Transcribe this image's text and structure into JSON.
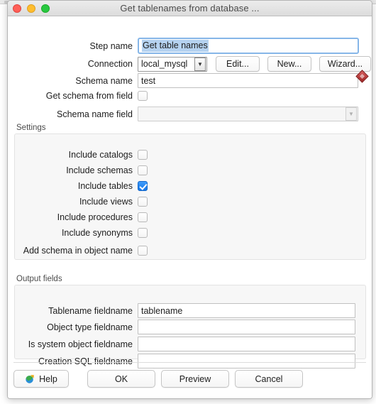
{
  "window": {
    "title": "Get tablenames from database ...",
    "traffic_lights": [
      "close-button",
      "minimize-button",
      "zoom-button"
    ]
  },
  "form": {
    "step_name": {
      "label": "Step name",
      "value": "Get table names",
      "selected": true
    },
    "connection": {
      "label": "Connection",
      "value": "local_mysql",
      "buttons": [
        {
          "name": "edit-button",
          "label": "Edit..."
        },
        {
          "name": "new-button",
          "label": "New..."
        },
        {
          "name": "wizard-button",
          "label": "Wizard..."
        }
      ]
    },
    "schema_name": {
      "label": "Schema name",
      "value": "test",
      "has_variable_marker": true
    },
    "get_schema_from_field": {
      "label": "Get schema from field",
      "checked": false
    },
    "schema_name_field": {
      "label": "Schema name field",
      "value": "",
      "disabled": true
    }
  },
  "settings": {
    "title": "Settings",
    "options": [
      {
        "label": "Include catalogs",
        "checked": false
      },
      {
        "label": "Include schemas",
        "checked": false
      },
      {
        "label": "Include tables",
        "checked": true
      },
      {
        "label": "Include views",
        "checked": false
      },
      {
        "label": "Include procedures",
        "checked": false
      },
      {
        "label": "Include synonyms",
        "checked": false
      },
      {
        "label": "Add schema in object name",
        "checked": false
      }
    ]
  },
  "output_fields": {
    "title": "Output fields",
    "rows": [
      {
        "label": "Tablename fieldname",
        "value": "tablename"
      },
      {
        "label": "Object type fieldname",
        "value": ""
      },
      {
        "label": "Is system object fieldname",
        "value": ""
      },
      {
        "label": "Creation SQL fieldname",
        "value": ""
      }
    ]
  },
  "footer": {
    "help": "Help",
    "ok": "OK",
    "preview": "Preview",
    "cancel": "Cancel"
  },
  "colors": {
    "accent_checkbox": "#1677e8",
    "selection": "#b5d2f0",
    "focus_border": "#86b6e8",
    "variable_marker": "#9e2020"
  }
}
